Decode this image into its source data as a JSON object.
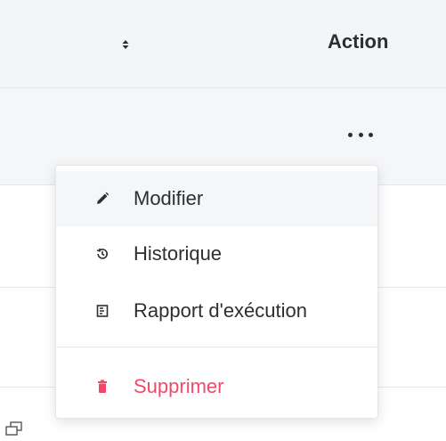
{
  "table": {
    "header": {
      "sort_icon": "sort-both-icon",
      "action_label": "Action"
    },
    "row_actions_icon": "more-horizontal-icon"
  },
  "menu": {
    "items": [
      {
        "label": "Modifier",
        "icon": "pencil-icon"
      },
      {
        "label": "Historique",
        "icon": "history-icon"
      },
      {
        "label": "Rapport d'exécution",
        "icon": "report-icon"
      },
      {
        "label": "Supprimer",
        "icon": "trash-icon"
      }
    ]
  },
  "colors": {
    "danger": "#ef4a6b",
    "text": "#2b2f33",
    "header_bg": "#f4f5f7"
  },
  "corner_icon": "window-restore-icon"
}
